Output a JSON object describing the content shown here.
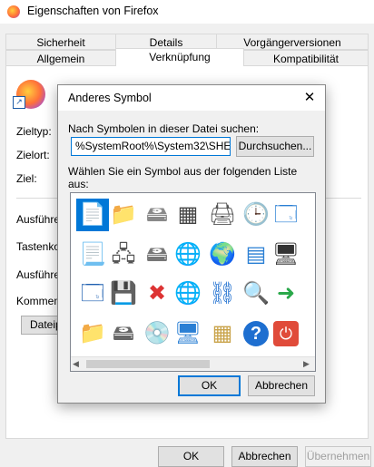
{
  "window": {
    "title": "Eigenschaften von Firefox"
  },
  "tabs_row1": [
    "Sicherheit",
    "Details",
    "Vorgängerversionen"
  ],
  "tabs_row2": [
    "Allgemein",
    "Verknüpfung",
    "Kompatibilität"
  ],
  "selected_tab": "Verknüpfung",
  "fields": {
    "target_type": "Zieltyp:",
    "target_location": "Zielort:",
    "target": "Ziel:",
    "run_in": "Ausführen",
    "shortcut_key": "Tastenko",
    "run_as": "Ausführen",
    "comment": "Kommenta",
    "open_location_button": "Dateipf"
  },
  "footer": {
    "ok": "OK",
    "cancel": "Abbrechen",
    "apply": "Übernehmen"
  },
  "dialog": {
    "title": "Anderes Symbol",
    "close_glyph": "✕",
    "search_label": "Nach Symbolen in dieser Datei suchen:",
    "path_value": "%SystemRoot%\\System32\\SHELL32.dll",
    "browse_button": "Durchsuchen...",
    "list_label": "Wählen Sie ein Symbol aus der folgenden Liste aus:",
    "ok": "OK",
    "cancel": "Abbrechen"
  },
  "icons": [
    [
      "document-icon",
      "folder-icon",
      "drive-icon",
      "chip-icon",
      "printer-icon",
      "clock-document-icon",
      "window-icon",
      "clipped-icon"
    ],
    [
      "text-document-icon",
      "network-drive-icon",
      "shared-drive-icon",
      "globe-icon",
      "network-globe-icon",
      "control-panel-icon",
      "monitor-icon",
      "clipped-icon"
    ],
    [
      "app-window-icon",
      "floppy-icon",
      "drive-error-icon",
      "globe-mouse-icon",
      "network-icon",
      "search-icon",
      "device-arrow-icon",
      "clipped-icon"
    ],
    [
      "folder-icon",
      "disk-drive-icon",
      "cd-drive-icon",
      "desktop-icon",
      "grid-document-icon",
      "help-icon",
      "power-icon",
      "clipped-icon"
    ]
  ]
}
